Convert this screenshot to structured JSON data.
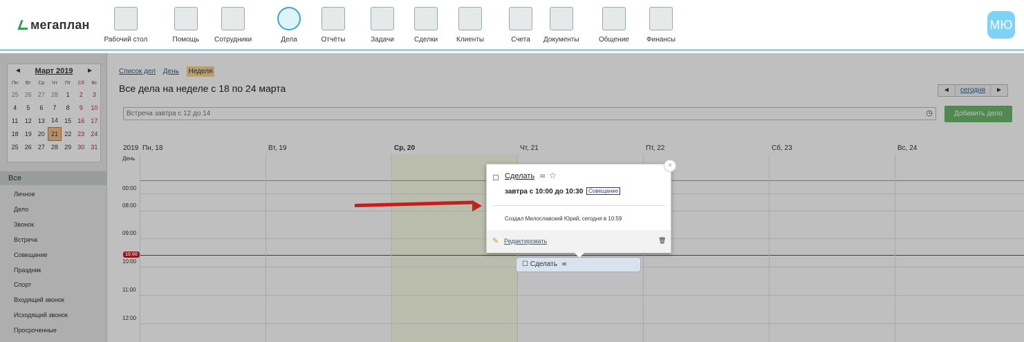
{
  "brand": {
    "logo_text": "мегаплан"
  },
  "nav": {
    "items": [
      {
        "label": "Рабочий стол",
        "icon": "desktop-icon"
      },
      {
        "label": "Помощь",
        "icon": "lifebuoy-icon"
      },
      {
        "label": "Сотрудники",
        "icon": "employees-icon"
      },
      {
        "label": "Дела",
        "icon": "clock-icon"
      },
      {
        "label": "Отчёты",
        "icon": "reports-icon"
      },
      {
        "label": "Задачи",
        "icon": "tasks-icon"
      },
      {
        "label": "Сделки",
        "icon": "briefcase-icon"
      },
      {
        "label": "Клиенты",
        "icon": "contacts-icon"
      },
      {
        "label": "Счета",
        "icon": "invoice-icon"
      },
      {
        "label": "Документы",
        "icon": "folder-icon"
      },
      {
        "label": "Общение",
        "icon": "chat-icon"
      },
      {
        "label": "Финансы",
        "icon": "safe-icon"
      }
    ],
    "active": "Дела"
  },
  "user": {
    "avatar_initials": "МЮ"
  },
  "mini_calendar": {
    "month": "Март 2019",
    "prev": "◄",
    "next": "►",
    "weekdays": [
      "Пн",
      "Вт",
      "Ср",
      "Чт",
      "Пт",
      "Сб",
      "Вс"
    ],
    "weeks": [
      [
        "25",
        "26",
        "27",
        "28",
        "1",
        "2",
        "3"
      ],
      [
        "4",
        "5",
        "6",
        "7",
        "8",
        "9",
        "10"
      ],
      [
        "11",
        "12",
        "13",
        "14",
        "15",
        "16",
        "17"
      ],
      [
        "18",
        "19",
        "20",
        "21",
        "22",
        "23",
        "24"
      ],
      [
        "25",
        "26",
        "27",
        "28",
        "29",
        "30",
        "31"
      ]
    ],
    "today": "21"
  },
  "categories": {
    "all": "Все",
    "items": [
      "Личное",
      "Дело",
      "Звонок",
      "Встреча",
      "Совещание",
      "Праздник",
      "Спорт",
      "Входящий звонок",
      "Исходящий звонок",
      "Просроченные"
    ]
  },
  "views": {
    "list": "Список дел",
    "day": "День",
    "week": "Неделя"
  },
  "page_title": "Все дела  на неделе с 18 по 24 марта",
  "pager": {
    "prev": "◄",
    "today": "сегодня",
    "next": "►"
  },
  "quick_add": {
    "placeholder": "Встреча завтра с 12 до 14",
    "button": "Добавить дело"
  },
  "week": {
    "year": "2019",
    "allday_label": "День",
    "days": [
      "Пн, 18",
      "Вт, 19",
      "Ср, 20",
      "Чт, 21",
      "Пт, 22",
      "Сб, 23",
      "Вс, 24"
    ],
    "times": [
      "00:00",
      "08:00",
      "09:00",
      "10:00",
      "11:00",
      "12:00"
    ],
    "now_badge": "10:00"
  },
  "event_chip": {
    "label": "Сделать"
  },
  "popup": {
    "title": "Сделать",
    "when": "завтра с 10:00 до 10:30",
    "tag": "Совещание",
    "creator": "Создал Милославский Юрий, сегодня в 10:59",
    "edit": "Редактировать",
    "close": "×"
  }
}
